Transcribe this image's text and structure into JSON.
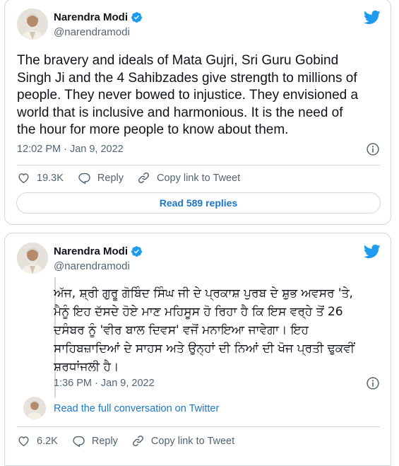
{
  "tweets": [
    {
      "author_name": "Narendra Modi",
      "author_handle": "@narendramodi",
      "text_lines": [
        "The bravery and ideals of Mata Gujri, Sri Guru Gobind",
        "Singh Ji and the 4 Sahibzades give strength to millions of",
        "people. They never bowed to injustice. They envisioned a",
        "world that is inclusive and harmonious. It is the need of",
        "the hour for more people to know about them."
      ],
      "timestamp": "12:02 PM · Jan 9, 2022",
      "likes": "19.3K",
      "reply_label": "Reply",
      "copy_link_label": "Copy link to Tweet",
      "read_replies_label": "Read 589 replies"
    },
    {
      "author_name": "Narendra Modi",
      "author_handle": "@narendramodi",
      "text_lines": [
        "ਅੱਜ, ਸ਼੍ਰੀ ਗੁਰੂ ਗੋਬਿੰਦ ਸਿੰਘ ਜੀ ਦੇ ਪ੍ਰਕਾਸ਼ ਪੁਰਬ ਦੇ ਸ਼ੁਭ ਅਵਸਰ 'ਤੇ,",
        "ਮੈਨੂੰ ਇਹ ਦੱਸਦੇ ਹੋਏ ਮਾਣ ਮਹਿਸੂਸ ਹੋ ਰਿਹਾ ਹੈ ਕਿ ਇਸ ਵਰ੍ਹੇ ਤੋਂ 26",
        "ਦਸੰਬਰ ਨੂੰ 'ਵੀਰ ਬਾਲ ਦਿਵਸ' ਵਜੋਂ ਮਨਾਇਆ ਜਾਵੇਗਾ। ਇਹ",
        "ਸਾਹਿਬਜ਼ਾਦਿਆਂ ਦੇ ਸਾਹਸ ਅਤੇ ਉਨ੍ਹਾਂ ਦੀ ਨਿਆਂ ਦੀ ਖੋਜ ਪ੍ਰਤੀ ਢੁਕਵੀਂ",
        "ਸ਼ਰਧਾਂਜਲੀ ਹੈ।"
      ],
      "timestamp": "1:36 PM · Jan 9, 2022",
      "read_conversation_label": "Read the full conversation on Twitter",
      "likes": "6.2K",
      "reply_label": "Reply",
      "copy_link_label": "Copy link to Tweet"
    }
  ],
  "colors": {
    "twitter_blue": "#1d9bf0",
    "link_blue": "#1d77c9",
    "text": "#0f1419",
    "secondary_text": "#536471",
    "border": "#cfd9de"
  },
  "icons": [
    "avatar",
    "verified-badge-icon",
    "twitter-bird-icon",
    "info-icon",
    "heart-icon",
    "reply-icon",
    "link-icon"
  ]
}
